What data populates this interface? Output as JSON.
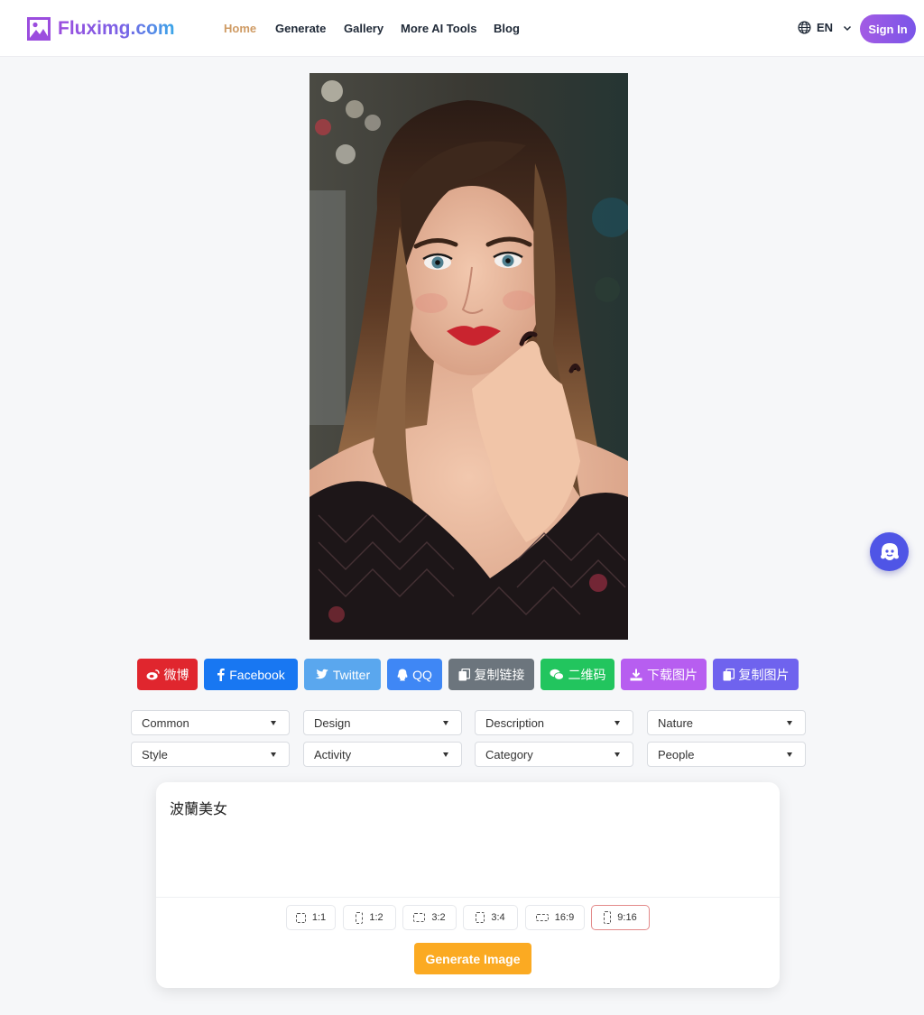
{
  "brand": {
    "name": "Fluximg.com"
  },
  "nav": {
    "items": [
      {
        "label": "Home",
        "active": true
      },
      {
        "label": "Generate"
      },
      {
        "label": "Gallery"
      },
      {
        "label": "More AI Tools"
      },
      {
        "label": "Blog"
      }
    ]
  },
  "header": {
    "language": "EN",
    "signin_label": "Sign In"
  },
  "share": {
    "weibo": "微博",
    "facebook": "Facebook",
    "twitter": "Twitter",
    "qq": "QQ",
    "copy_link": "复制链接",
    "qrcode": "二维码",
    "download": "下载图片",
    "copy_image": "复制图片"
  },
  "filters": {
    "row1": [
      "Common",
      "Design",
      "Description",
      "Nature"
    ],
    "row2": [
      "Style",
      "Activity",
      "Category",
      "People"
    ]
  },
  "prompt": {
    "value": "波蘭美女"
  },
  "ratios": {
    "options": [
      "1:1",
      "1:2",
      "3:2",
      "3:4",
      "16:9",
      "9:16"
    ],
    "selected": "9:16"
  },
  "generate": {
    "label": "Generate Image"
  },
  "colors": {
    "brand_purple": "#9b4dde",
    "active_nav": "#cf9b64",
    "weibo": "#e0262e",
    "facebook": "#1877f2",
    "twitter": "#5aa7ee",
    "qq": "#3f87f5",
    "copy_link": "#6c757d",
    "qrcode": "#22c55e",
    "download": "#b75ef0",
    "copy_image": "#6f63ee",
    "generate": "#fbaa22"
  }
}
